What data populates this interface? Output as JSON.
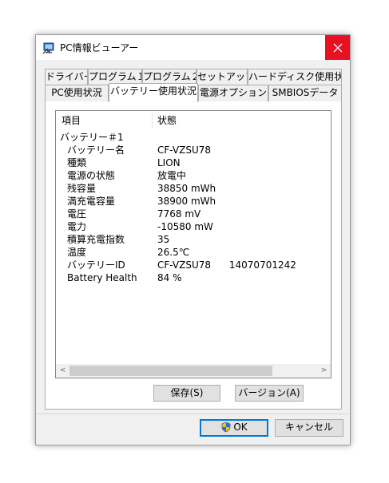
{
  "window": {
    "title": "PC情報ビューアー",
    "close_glyph": "✕"
  },
  "tabs": {
    "back_row": [
      "ドライバー",
      "プログラム１",
      "プログラム２",
      "セットアップ",
      "ハードディスク使用状況"
    ],
    "front_row": [
      "PC使用状況",
      "バッテリー使用状況",
      "電源オプション",
      "SMBIOSデータ"
    ],
    "selected": "バッテリー使用状況"
  },
  "list": {
    "headers": [
      "項目",
      "状態"
    ],
    "group": "バッテリー＃1",
    "rows": [
      {
        "label": "バッテリー名",
        "value": "CF-VZSU78"
      },
      {
        "label": "種類",
        "value": "LION"
      },
      {
        "label": "電源の状態",
        "value": "放電中"
      },
      {
        "label": "残容量",
        "value": "38850 mWh"
      },
      {
        "label": "満充電容量",
        "value": "38900 mWh"
      },
      {
        "label": "電圧",
        "value": "7768 mV"
      },
      {
        "label": "電力",
        "value": "-10580 mW"
      },
      {
        "label": "積算充電指数",
        "value": "35"
      },
      {
        "label": "温度",
        "value": "26.5℃"
      },
      {
        "label": "バッテリーID",
        "value": "CF-VZSU78      14070701242"
      },
      {
        "label": "Battery Health",
        "value": "84 %"
      }
    ]
  },
  "buttons": {
    "save": "保存(S)",
    "version": "バージョン(A)",
    "ok": "OK",
    "cancel": "キャンセル"
  },
  "scrollbar": {
    "left_arrow": "<",
    "right_arrow": ">"
  },
  "colors": {
    "close_bg": "#e81123",
    "default_button_border": "#0078d7"
  }
}
